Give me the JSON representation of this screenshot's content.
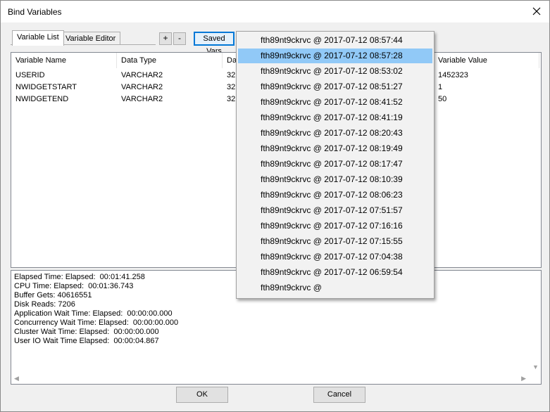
{
  "window": {
    "title": "Bind Variables"
  },
  "tabs": [
    {
      "label": "Variable List",
      "active": true
    },
    {
      "label": "Variable Editor",
      "active": false
    }
  ],
  "toolbar": {
    "add_label": "+",
    "remove_label": "-",
    "saved_vars_label": "Saved Vars"
  },
  "table": {
    "columns": [
      "Variable Name",
      "Data Type",
      "Da",
      "Variable Value"
    ],
    "rows": [
      {
        "name": "USERID",
        "type": "VARCHAR2",
        "size": "32",
        "value": "1452323"
      },
      {
        "name": "NWIDGETSTART",
        "type": "VARCHAR2",
        "size": "32",
        "value": "1"
      },
      {
        "name": "NWIDGETEND",
        "type": "VARCHAR2",
        "size": "32",
        "value": "50"
      }
    ]
  },
  "stats": [
    "Elapsed Time: Elapsed:  00:01:41.258",
    "CPU Time: Elapsed:  00:01:36.743",
    "Buffer Gets: 40616551",
    "Disk Reads: 7206",
    "Application Wait Time: Elapsed:  00:00:00.000",
    "Concurrency Wait Time: Elapsed:  00:00:00.000",
    "Cluster Wait Time: Elapsed:  00:00:00.000",
    "User IO Wait Time Elapsed:  00:00:04.867"
  ],
  "dropdown": {
    "selected_index": 1,
    "items": [
      "fth89nt9ckrvc @ 2017-07-12 08:57:44",
      "fth89nt9ckrvc @ 2017-07-12 08:57:28",
      "fth89nt9ckrvc @ 2017-07-12 08:53:02",
      "fth89nt9ckrvc @ 2017-07-12 08:51:27",
      "fth89nt9ckrvc @ 2017-07-12 08:41:52",
      "fth89nt9ckrvc @ 2017-07-12 08:41:19",
      "fth89nt9ckrvc @ 2017-07-12 08:20:43",
      "fth89nt9ckrvc @ 2017-07-12 08:19:49",
      "fth89nt9ckrvc @ 2017-07-12 08:17:47",
      "fth89nt9ckrvc @ 2017-07-12 08:10:39",
      "fth89nt9ckrvc @ 2017-07-12 08:06:23",
      "fth89nt9ckrvc @ 2017-07-12 07:51:57",
      "fth89nt9ckrvc @ 2017-07-12 07:16:16",
      "fth89nt9ckrvc @ 2017-07-12 07:15:55",
      "fth89nt9ckrvc @ 2017-07-12 07:04:38",
      "fth89nt9ckrvc @ 2017-07-12 06:59:54",
      "fth89nt9ckrvc @"
    ]
  },
  "buttons": {
    "ok_label": "OK",
    "cancel_label": "Cancel"
  },
  "icons": {
    "close": "close-icon",
    "scroll_left": "chevron-left-icon",
    "scroll_right": "chevron-right-icon",
    "scroll_down": "chevron-down-icon"
  },
  "colors": {
    "selection": "#91c9f7",
    "focus": "#0078d7"
  }
}
